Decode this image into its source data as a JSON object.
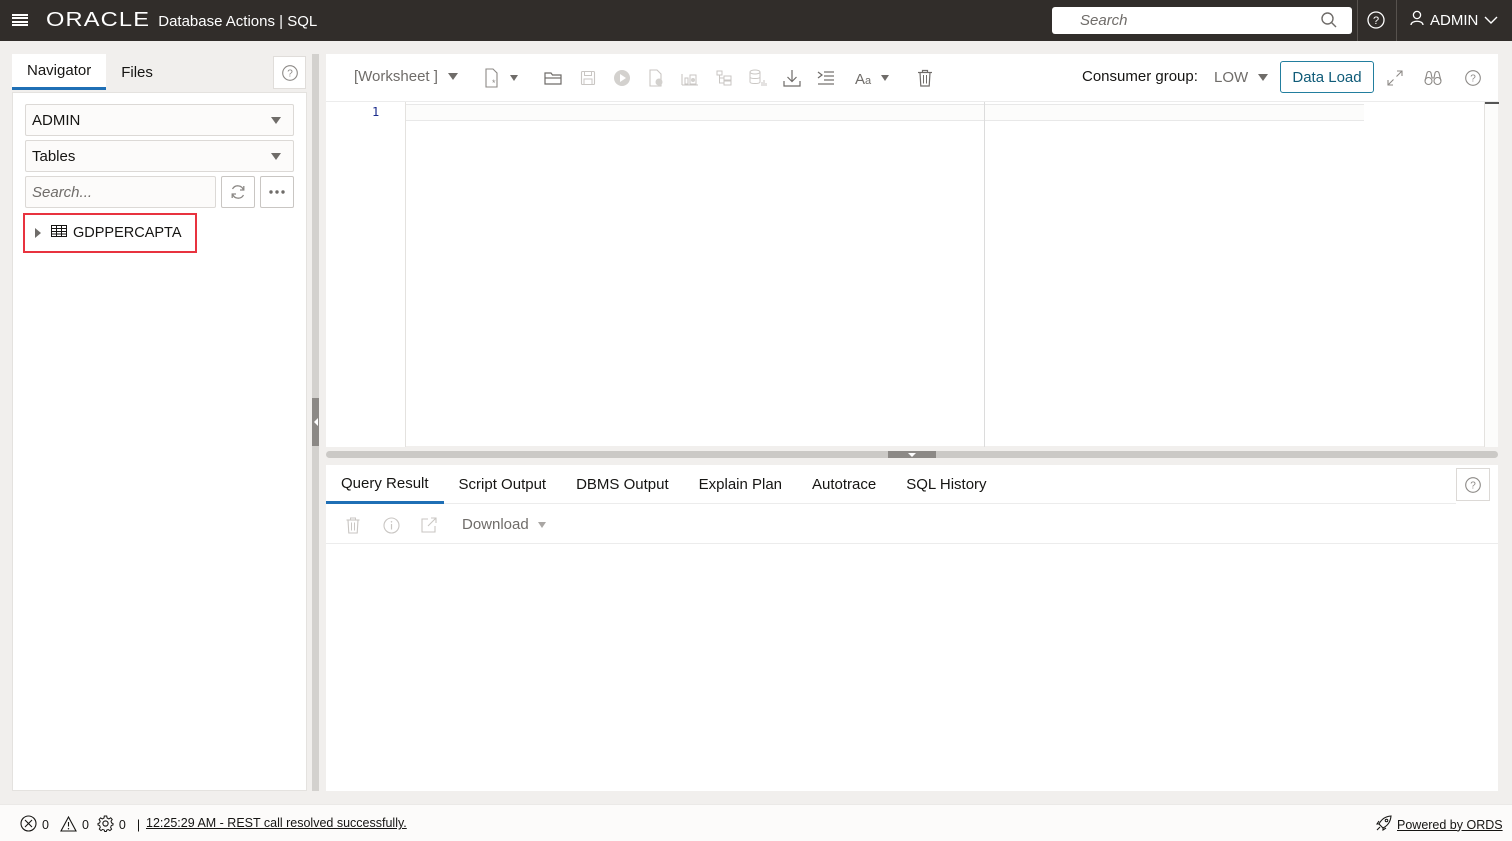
{
  "header": {
    "logo": "ORACLE",
    "app_title": "Database Actions |  SQL",
    "search_placeholder": "Search",
    "user": "ADMIN"
  },
  "navigator": {
    "tabs": [
      {
        "label": "Navigator",
        "active": true
      },
      {
        "label": "Files",
        "active": false
      }
    ],
    "schema_select": "ADMIN",
    "object_type_select": "Tables",
    "search_placeholder": "Search...",
    "tree_items": [
      {
        "label": "GDPPERCAPTA",
        "icon": "table-icon",
        "expanded": false,
        "highlighted": true
      }
    ]
  },
  "editor_toolbar": {
    "worksheet_label": "[Worksheet ]",
    "icons": [
      "new-worksheet-icon",
      "open-folder-icon",
      "save-icon",
      "run-statement-icon",
      "run-script-icon",
      "explain-plan-icon",
      "autotrace-icon",
      "sql-tuning-icon",
      "download-icon",
      "format-icon",
      "text-size-icon",
      "clear-icon"
    ],
    "consumer_group_label": "Consumer group:",
    "consumer_group_value": "LOW",
    "data_load_label": "Data Load"
  },
  "editor": {
    "line_numbers": [
      "1"
    ],
    "content": ""
  },
  "results": {
    "tabs": [
      {
        "label": "Query Result",
        "active": true
      },
      {
        "label": "Script Output",
        "active": false
      },
      {
        "label": "DBMS Output",
        "active": false
      },
      {
        "label": "Explain Plan",
        "active": false
      },
      {
        "label": "Autotrace",
        "active": false
      },
      {
        "label": "SQL History",
        "active": false
      }
    ],
    "download_label": "Download"
  },
  "status_bar": {
    "errors": "0",
    "warnings": "0",
    "processes": "0",
    "separator": "|",
    "message": "12:25:29 AM - REST call resolved successfully.",
    "powered_by": "Powered by ORDS"
  },
  "colors": {
    "header_bg": "#312d2a",
    "accent_blue": "#1f6fb5",
    "data_load_border": "#227e9e",
    "highlight_red": "#e8333f"
  }
}
